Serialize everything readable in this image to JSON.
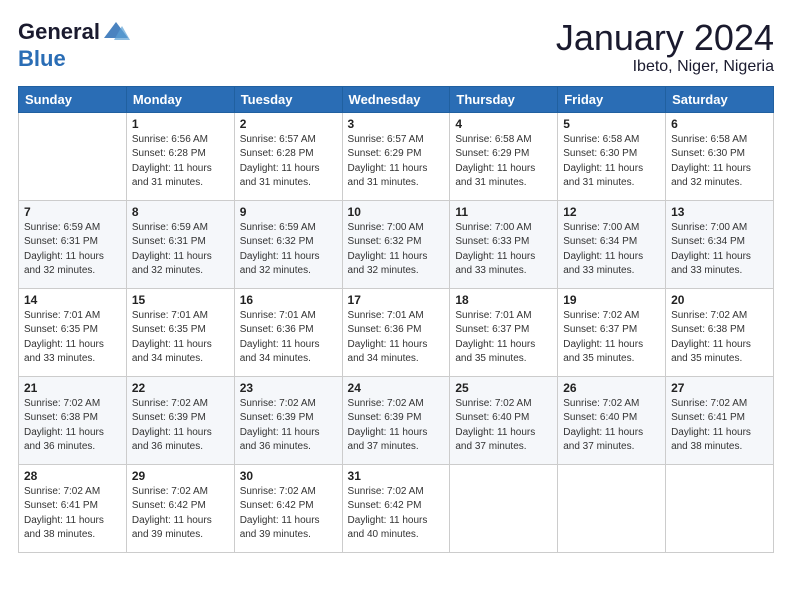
{
  "header": {
    "logo_general": "General",
    "logo_blue": "Blue",
    "month_title": "January 2024",
    "location": "Ibeto, Niger, Nigeria"
  },
  "weekdays": [
    "Sunday",
    "Monday",
    "Tuesday",
    "Wednesday",
    "Thursday",
    "Friday",
    "Saturday"
  ],
  "weeks": [
    [
      {
        "day": "",
        "sunrise": "",
        "sunset": "",
        "daylight": ""
      },
      {
        "day": "1",
        "sunrise": "6:56 AM",
        "sunset": "6:28 PM",
        "daylight": "11 hours and 31 minutes."
      },
      {
        "day": "2",
        "sunrise": "6:57 AM",
        "sunset": "6:28 PM",
        "daylight": "11 hours and 31 minutes."
      },
      {
        "day": "3",
        "sunrise": "6:57 AM",
        "sunset": "6:29 PM",
        "daylight": "11 hours and 31 minutes."
      },
      {
        "day": "4",
        "sunrise": "6:58 AM",
        "sunset": "6:29 PM",
        "daylight": "11 hours and 31 minutes."
      },
      {
        "day": "5",
        "sunrise": "6:58 AM",
        "sunset": "6:30 PM",
        "daylight": "11 hours and 31 minutes."
      },
      {
        "day": "6",
        "sunrise": "6:58 AM",
        "sunset": "6:30 PM",
        "daylight": "11 hours and 32 minutes."
      }
    ],
    [
      {
        "day": "7",
        "sunrise": "6:59 AM",
        "sunset": "6:31 PM",
        "daylight": "11 hours and 32 minutes."
      },
      {
        "day": "8",
        "sunrise": "6:59 AM",
        "sunset": "6:31 PM",
        "daylight": "11 hours and 32 minutes."
      },
      {
        "day": "9",
        "sunrise": "6:59 AM",
        "sunset": "6:32 PM",
        "daylight": "11 hours and 32 minutes."
      },
      {
        "day": "10",
        "sunrise": "7:00 AM",
        "sunset": "6:32 PM",
        "daylight": "11 hours and 32 minutes."
      },
      {
        "day": "11",
        "sunrise": "7:00 AM",
        "sunset": "6:33 PM",
        "daylight": "11 hours and 33 minutes."
      },
      {
        "day": "12",
        "sunrise": "7:00 AM",
        "sunset": "6:34 PM",
        "daylight": "11 hours and 33 minutes."
      },
      {
        "day": "13",
        "sunrise": "7:00 AM",
        "sunset": "6:34 PM",
        "daylight": "11 hours and 33 minutes."
      }
    ],
    [
      {
        "day": "14",
        "sunrise": "7:01 AM",
        "sunset": "6:35 PM",
        "daylight": "11 hours and 33 minutes."
      },
      {
        "day": "15",
        "sunrise": "7:01 AM",
        "sunset": "6:35 PM",
        "daylight": "11 hours and 34 minutes."
      },
      {
        "day": "16",
        "sunrise": "7:01 AM",
        "sunset": "6:36 PM",
        "daylight": "11 hours and 34 minutes."
      },
      {
        "day": "17",
        "sunrise": "7:01 AM",
        "sunset": "6:36 PM",
        "daylight": "11 hours and 34 minutes."
      },
      {
        "day": "18",
        "sunrise": "7:01 AM",
        "sunset": "6:37 PM",
        "daylight": "11 hours and 35 minutes."
      },
      {
        "day": "19",
        "sunrise": "7:02 AM",
        "sunset": "6:37 PM",
        "daylight": "11 hours and 35 minutes."
      },
      {
        "day": "20",
        "sunrise": "7:02 AM",
        "sunset": "6:38 PM",
        "daylight": "11 hours and 35 minutes."
      }
    ],
    [
      {
        "day": "21",
        "sunrise": "7:02 AM",
        "sunset": "6:38 PM",
        "daylight": "11 hours and 36 minutes."
      },
      {
        "day": "22",
        "sunrise": "7:02 AM",
        "sunset": "6:39 PM",
        "daylight": "11 hours and 36 minutes."
      },
      {
        "day": "23",
        "sunrise": "7:02 AM",
        "sunset": "6:39 PM",
        "daylight": "11 hours and 36 minutes."
      },
      {
        "day": "24",
        "sunrise": "7:02 AM",
        "sunset": "6:39 PM",
        "daylight": "11 hours and 37 minutes."
      },
      {
        "day": "25",
        "sunrise": "7:02 AM",
        "sunset": "6:40 PM",
        "daylight": "11 hours and 37 minutes."
      },
      {
        "day": "26",
        "sunrise": "7:02 AM",
        "sunset": "6:40 PM",
        "daylight": "11 hours and 37 minutes."
      },
      {
        "day": "27",
        "sunrise": "7:02 AM",
        "sunset": "6:41 PM",
        "daylight": "11 hours and 38 minutes."
      }
    ],
    [
      {
        "day": "28",
        "sunrise": "7:02 AM",
        "sunset": "6:41 PM",
        "daylight": "11 hours and 38 minutes."
      },
      {
        "day": "29",
        "sunrise": "7:02 AM",
        "sunset": "6:42 PM",
        "daylight": "11 hours and 39 minutes."
      },
      {
        "day": "30",
        "sunrise": "7:02 AM",
        "sunset": "6:42 PM",
        "daylight": "11 hours and 39 minutes."
      },
      {
        "day": "31",
        "sunrise": "7:02 AM",
        "sunset": "6:42 PM",
        "daylight": "11 hours and 40 minutes."
      },
      {
        "day": "",
        "sunrise": "",
        "sunset": "",
        "daylight": ""
      },
      {
        "day": "",
        "sunrise": "",
        "sunset": "",
        "daylight": ""
      },
      {
        "day": "",
        "sunrise": "",
        "sunset": "",
        "daylight": ""
      }
    ]
  ]
}
